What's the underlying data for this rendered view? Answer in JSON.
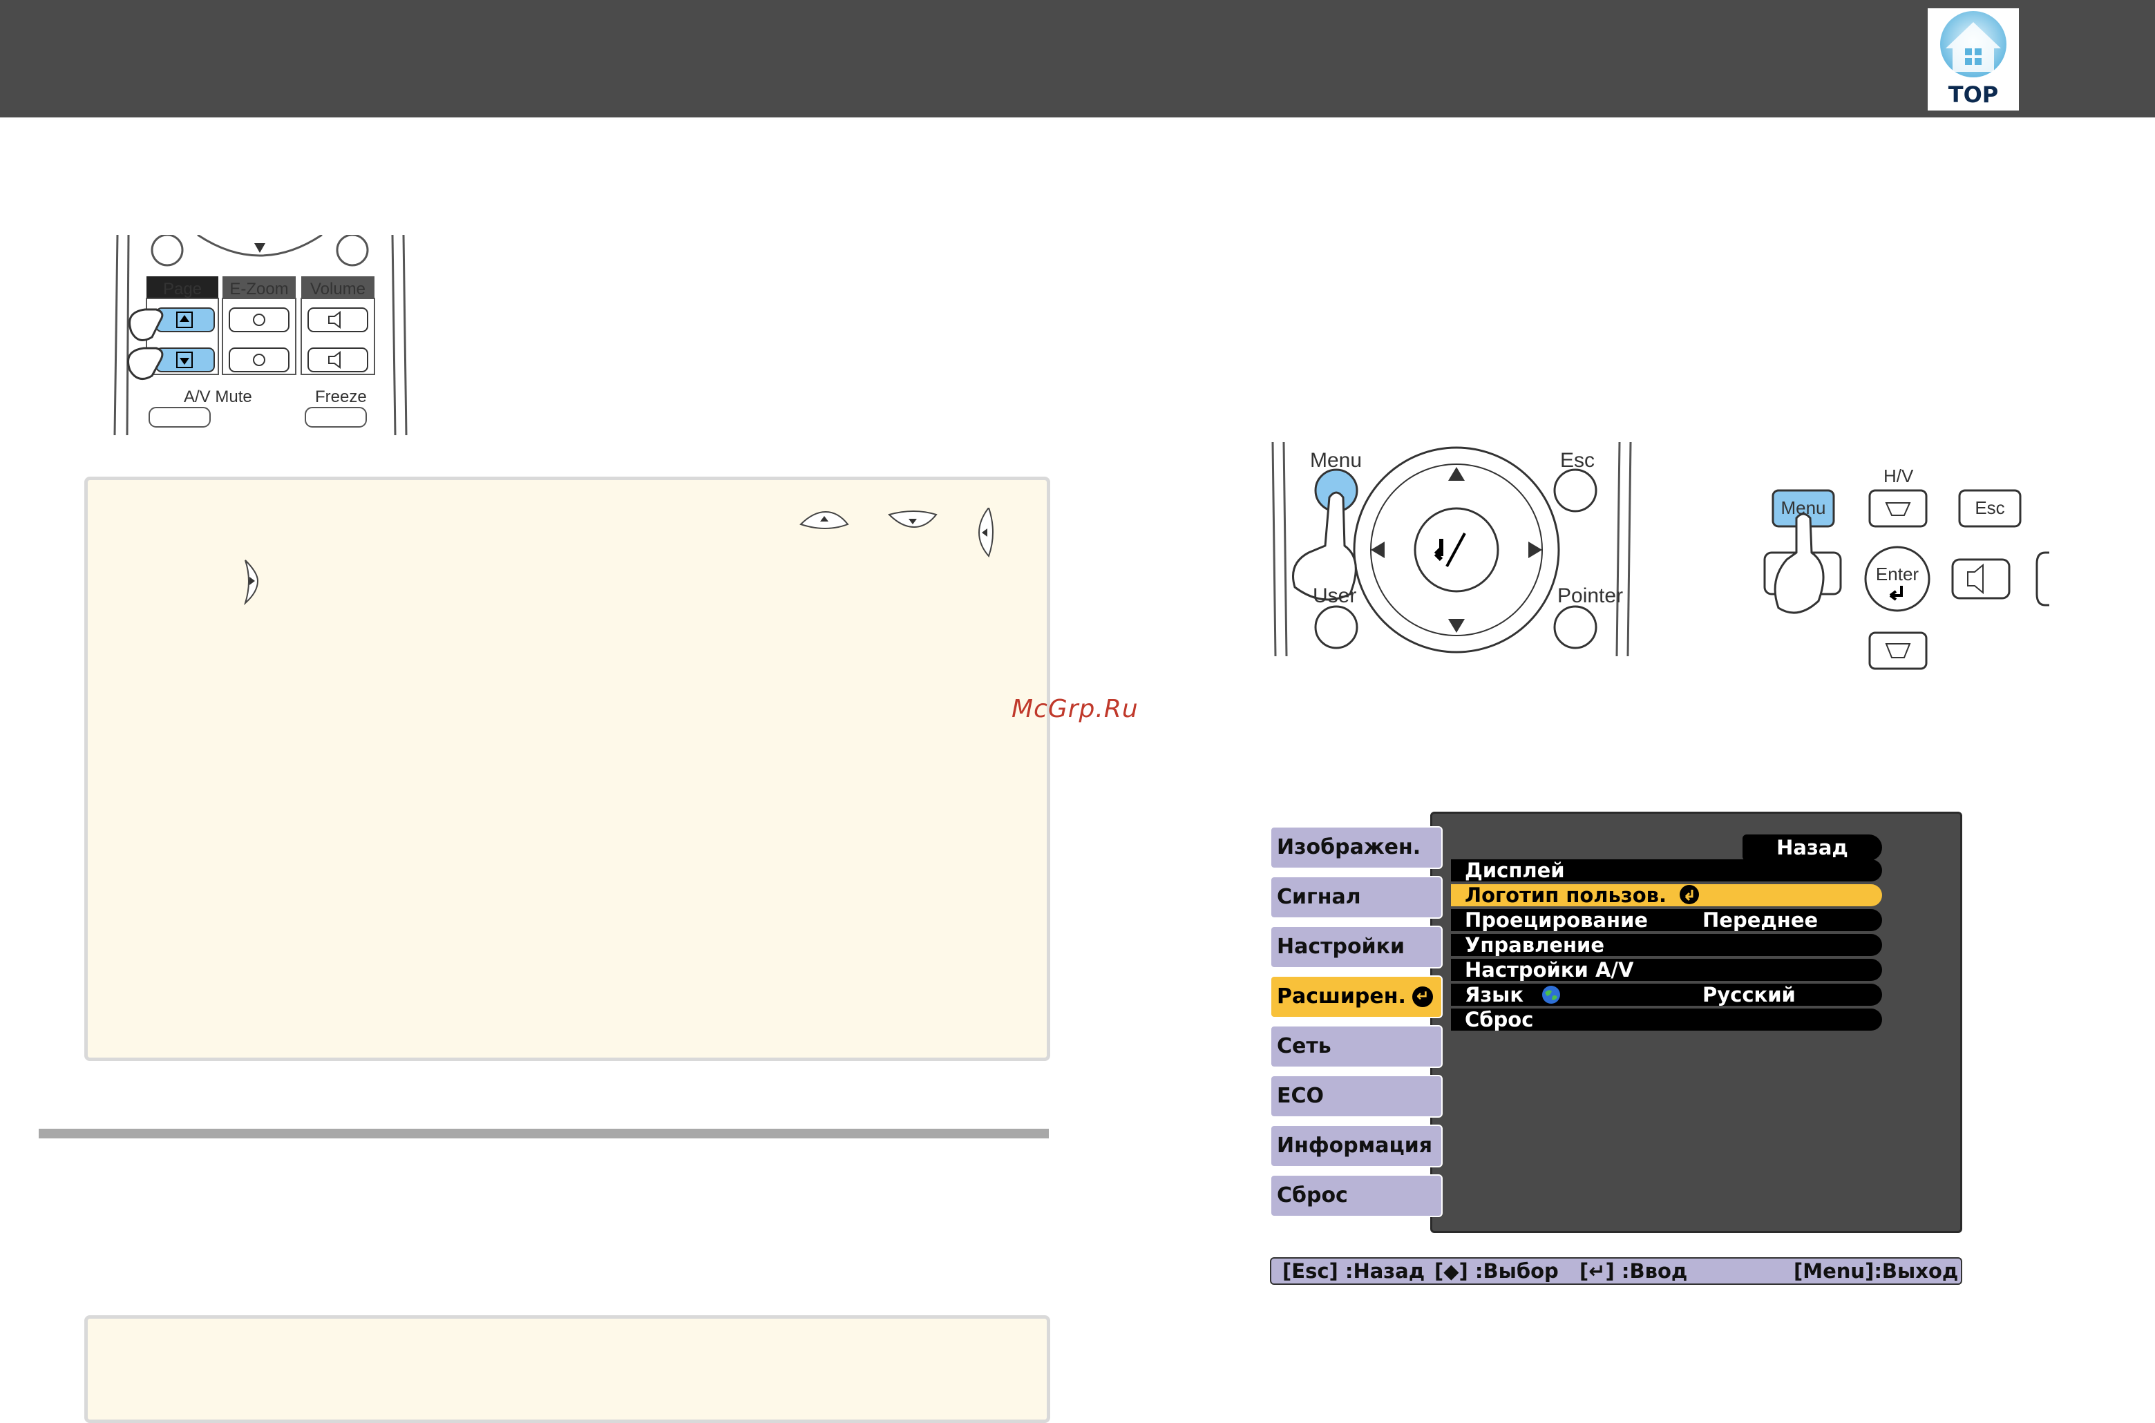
{
  "header": {
    "logo_text": "TOP"
  },
  "remote_page": {
    "page_label": "Page",
    "ezoom_label": "E-Zoom",
    "volume_label": "Volume",
    "av_mute_label": "A/V Mute",
    "freeze_label": "Freeze"
  },
  "remote_menu": {
    "menu_label": "Menu",
    "esc_label": "Esc",
    "user_label": "User",
    "pointer_label": "Pointer"
  },
  "panel": {
    "hv_label": "H/V",
    "menu_label": "Menu",
    "esc_label": "Esc",
    "enter_label": "Enter"
  },
  "watermark": "McGrp.Ru",
  "projector_menu": {
    "tabs": [
      {
        "label": "Изображен."
      },
      {
        "label": "Сигнал"
      },
      {
        "label": "Настройки"
      },
      {
        "label": "Расширен."
      },
      {
        "label": "Сеть"
      },
      {
        "label": "ECO"
      },
      {
        "label": "Информация"
      },
      {
        "label": "Сброс"
      }
    ],
    "selected_tab": "Расширен.",
    "back_label": "Назад",
    "rows": [
      {
        "label": "Дисплей",
        "value": ""
      },
      {
        "label": "Логотип пользов.",
        "value": ""
      },
      {
        "label": "Проецирование",
        "value": "Переднее"
      },
      {
        "label": "Управление",
        "value": ""
      },
      {
        "label": "Настройки A/V",
        "value": ""
      },
      {
        "label": "Язык",
        "value": "Русский"
      },
      {
        "label": "Сброс",
        "value": ""
      }
    ],
    "selected_row": "Логотип пользов.",
    "status": {
      "esc": "[Esc] :Назад",
      "select": "[◆] :Выбор",
      "enter": "[↵] :Ввод",
      "exit": "[Menu]:Выход"
    }
  },
  "colors": {
    "header_bg": "#4b4b4b",
    "note_bg": "#fef9e9",
    "menu_highlight": "#f8c13a",
    "menu_tab": "#b8b4d6",
    "button_blue": "#8cc8ef"
  }
}
